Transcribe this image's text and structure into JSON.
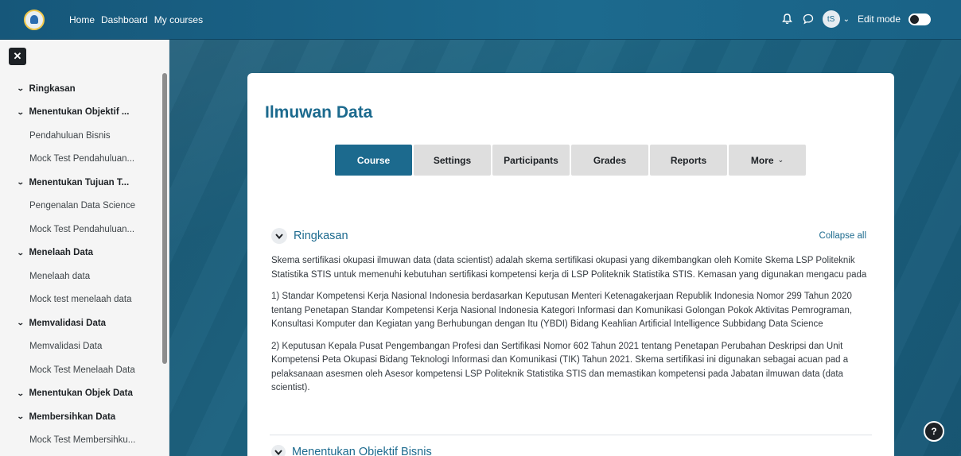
{
  "navbar": {
    "links": [
      "Home",
      "Dashboard",
      "My courses"
    ],
    "avatar_initials": "tS",
    "edit_mode_label": "Edit mode"
  },
  "drawer": {
    "items": [
      {
        "type": "section",
        "label": "Ringkasan"
      },
      {
        "type": "section",
        "label": "Menentukan Objektif ..."
      },
      {
        "type": "activity",
        "label": "Pendahuluan Bisnis"
      },
      {
        "type": "activity",
        "label": "Mock Test Pendahuluan..."
      },
      {
        "type": "section",
        "label": "Menentukan Tujuan T..."
      },
      {
        "type": "activity",
        "label": "Pengenalan Data Science"
      },
      {
        "type": "activity",
        "label": "Mock Test Pendahuluan..."
      },
      {
        "type": "section",
        "label": "Menelaah Data"
      },
      {
        "type": "activity",
        "label": "Menelaah data"
      },
      {
        "type": "activity",
        "label": "Mock test menelaah data"
      },
      {
        "type": "section",
        "label": "Memvalidasi Data"
      },
      {
        "type": "activity",
        "label": "Memvalidasi Data"
      },
      {
        "type": "activity",
        "label": "Mock Test Menelaah Data"
      },
      {
        "type": "section",
        "label": "Menentukan Objek Data"
      },
      {
        "type": "section",
        "label": "Membersihkan Data"
      },
      {
        "type": "activity",
        "label": "Mock Test Membersihku..."
      }
    ]
  },
  "course": {
    "title": "Ilmuwan Data",
    "tabs": [
      "Course",
      "Settings",
      "Participants",
      "Grades",
      "Reports",
      "More"
    ],
    "active_tab": "Course",
    "collapse_all": "Collapse all",
    "section_title": "Ringkasan",
    "summary": [
      "Skema sertifikasi okupasi ilmuwan data (data scientist) adalah skema sertifikasi okupasi yang dikembangkan oleh Komite Skema LSP Politeknik Statistika STIS untuk memenuhi kebutuhan sertifikasi kompetensi kerja di LSP Politeknik Statistika STIS. Kemasan yang digunakan mengacu pada",
      "1) Standar Kompetensi Kerja Nasional Indonesia berdasarkan Keputusan Menteri Ketenagakerjaan Republik Indonesia Nomor 299 Tahun 2020 tentang Penetapan Standar Kompetensi Kerja Nasional Indonesia Kategori Informasi dan Komunikasi Golongan Pokok Aktivitas Pemrograman, Konsultasi Komputer dan Kegiatan yang Berhubungan dengan Itu (YBDI) Bidang Keahlian Artificial Intelligence Subbidang Data Science",
      "2) Keputusan Kepala Pusat Pengembangan Profesi dan Sertifikasi Nomor 602 Tahun 2021 tentang Penetapan Perubahan Deskripsi dan Unit Kompetensi Peta Okupasi Bidang Teknologi Informasi dan Komunikasi (TIK) Tahun 2021. Skema sertifikasi ini digunakan sebagai acuan pad a pelaksanaan asesmen oleh Asesor kompetensi LSP Politeknik Statistika STIS dan memastikan kompetensi pada Jabatan ilmuwan data (data scientist)."
    ],
    "next_section_title": "Menentukan Objektif Bisnis"
  },
  "help_label": "?",
  "colors": {
    "accent": "#1c6a8e",
    "navbar": "#1c6a8e",
    "tab_inactive": "#dedede"
  }
}
